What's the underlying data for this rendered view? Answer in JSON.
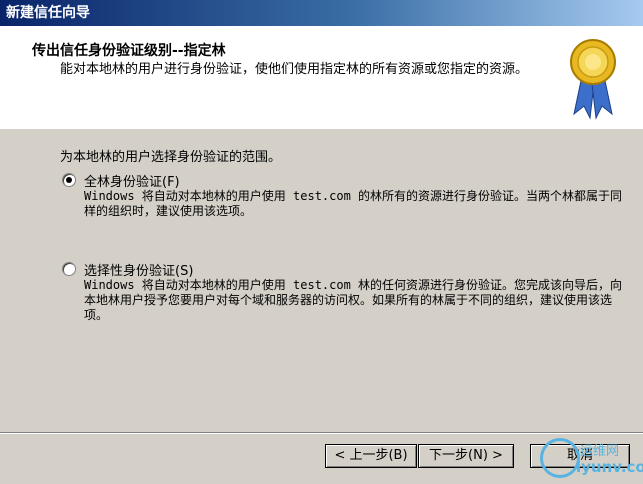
{
  "window": {
    "title": "新建信任向导"
  },
  "header": {
    "title": "传出信任身份验证级别--指定林",
    "description": "能对本地林的用户进行身份验证，使他们使用指定林的所有资源或您指定的资源。",
    "seal_icon": "award-ribbon-icon"
  },
  "main": {
    "prompt": "为本地林的用户选择身份验证的范围。",
    "options": [
      {
        "label": "全林身份验证(F)",
        "selected": true,
        "description": "Windows 将自动对本地林的用户使用 test.com 的林所有的资源进行身份验证。当两个林都属于同样的组织时，建议使用该选项。"
      },
      {
        "label": "选择性身份验证(S)",
        "selected": false,
        "description": "Windows 将自动对本地林的用户使用 test.com 林的任何资源进行身份验证。您完成该向导后，向本地林用户授予您要用户对每个域和服务器的访问权。如果所有的林属于不同的组织，建议使用该选项。"
      }
    ]
  },
  "footer": {
    "back_label": "< 上一步(B)",
    "next_label": "下一步(N) >",
    "cancel_label": "取消"
  },
  "watermark": {
    "line1": "运维网",
    "line2": "iyunv.com"
  }
}
